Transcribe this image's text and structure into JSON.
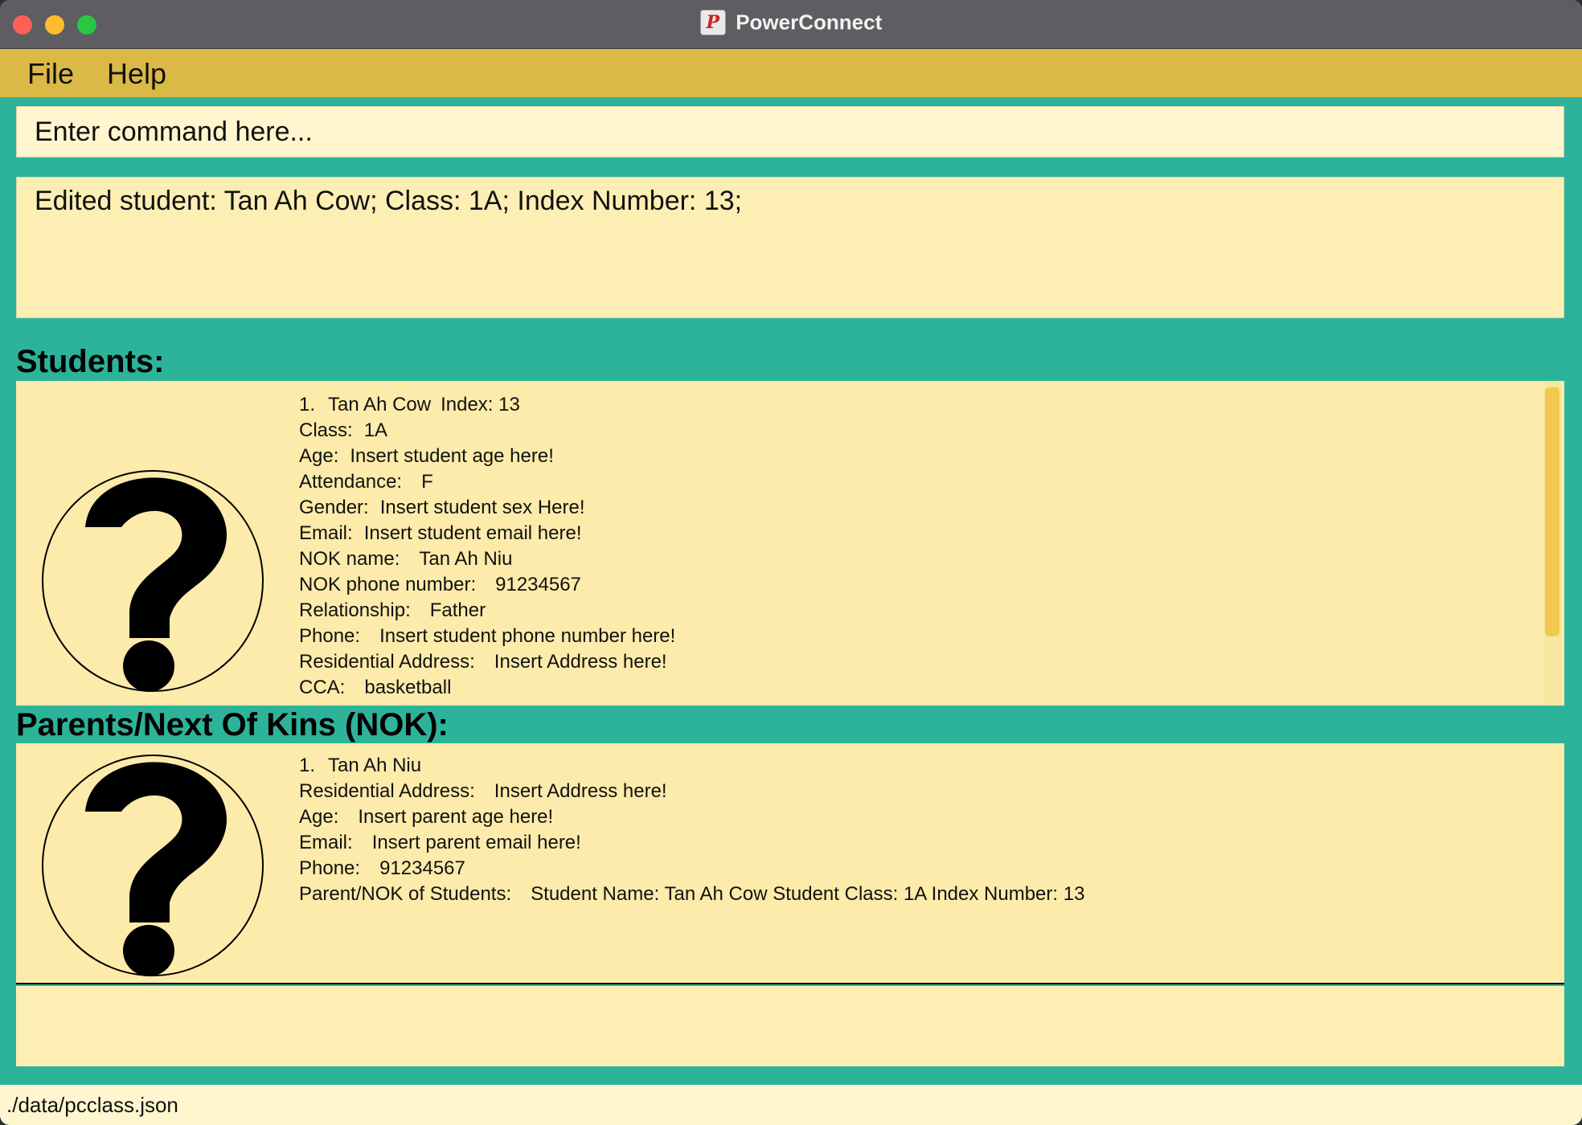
{
  "window": {
    "title": "PowerConnect",
    "icon": "P"
  },
  "menu": {
    "file": "File",
    "help": "Help"
  },
  "command": {
    "placeholder": "Enter command here..."
  },
  "result": {
    "text": "Edited student: Tan Ah Cow; Class: 1A; Index Number: 13;"
  },
  "students": {
    "heading": "Students:",
    "items": [
      {
        "number": "1.",
        "name": "Tan Ah Cow",
        "index_label": "Index:",
        "index": "13",
        "fields": [
          {
            "label": "Class:",
            "value": "1A"
          },
          {
            "label": "Age:",
            "value": "Insert student age here!"
          },
          {
            "label": "Attendance:",
            "value": "F"
          },
          {
            "label": "Gender:",
            "value": "Insert student sex Here!"
          },
          {
            "label": "Email:",
            "value": "Insert student email here!"
          },
          {
            "label": "NOK name:",
            "value": "Tan Ah Niu"
          },
          {
            "label": "NOK phone number:",
            "value": "91234567"
          },
          {
            "label": "Relationship:",
            "value": "Father"
          },
          {
            "label": "Phone:",
            "value": "Insert student phone number here!"
          },
          {
            "label": "Residential Address:",
            "value": "Insert Address here!"
          },
          {
            "label": "CCA:",
            "value": "basketball"
          }
        ]
      }
    ]
  },
  "parents": {
    "heading": "Parents/Next Of Kins (NOK):",
    "items": [
      {
        "number": "1.",
        "name": "Tan Ah Niu",
        "fields": [
          {
            "label": "Residential Address:",
            "value": "Insert Address here!"
          },
          {
            "label": "Age:",
            "value": "Insert parent age here!"
          },
          {
            "label": "Email:",
            "value": "Insert parent email here!"
          },
          {
            "label": "Phone:",
            "value": "91234567"
          },
          {
            "label": "Parent/NOK of Students:",
            "value": "Student Name: Tan Ah Cow Student Class: 1A Index Number: 13"
          }
        ]
      }
    ]
  },
  "status": {
    "path": "./data/pcclass.json"
  },
  "colors": {
    "background": "#2db39a",
    "menubar": "#dbb947",
    "panel": "#fcebaa",
    "titlebar": "#5e5d62",
    "scrollbar": "#f2c94c"
  }
}
